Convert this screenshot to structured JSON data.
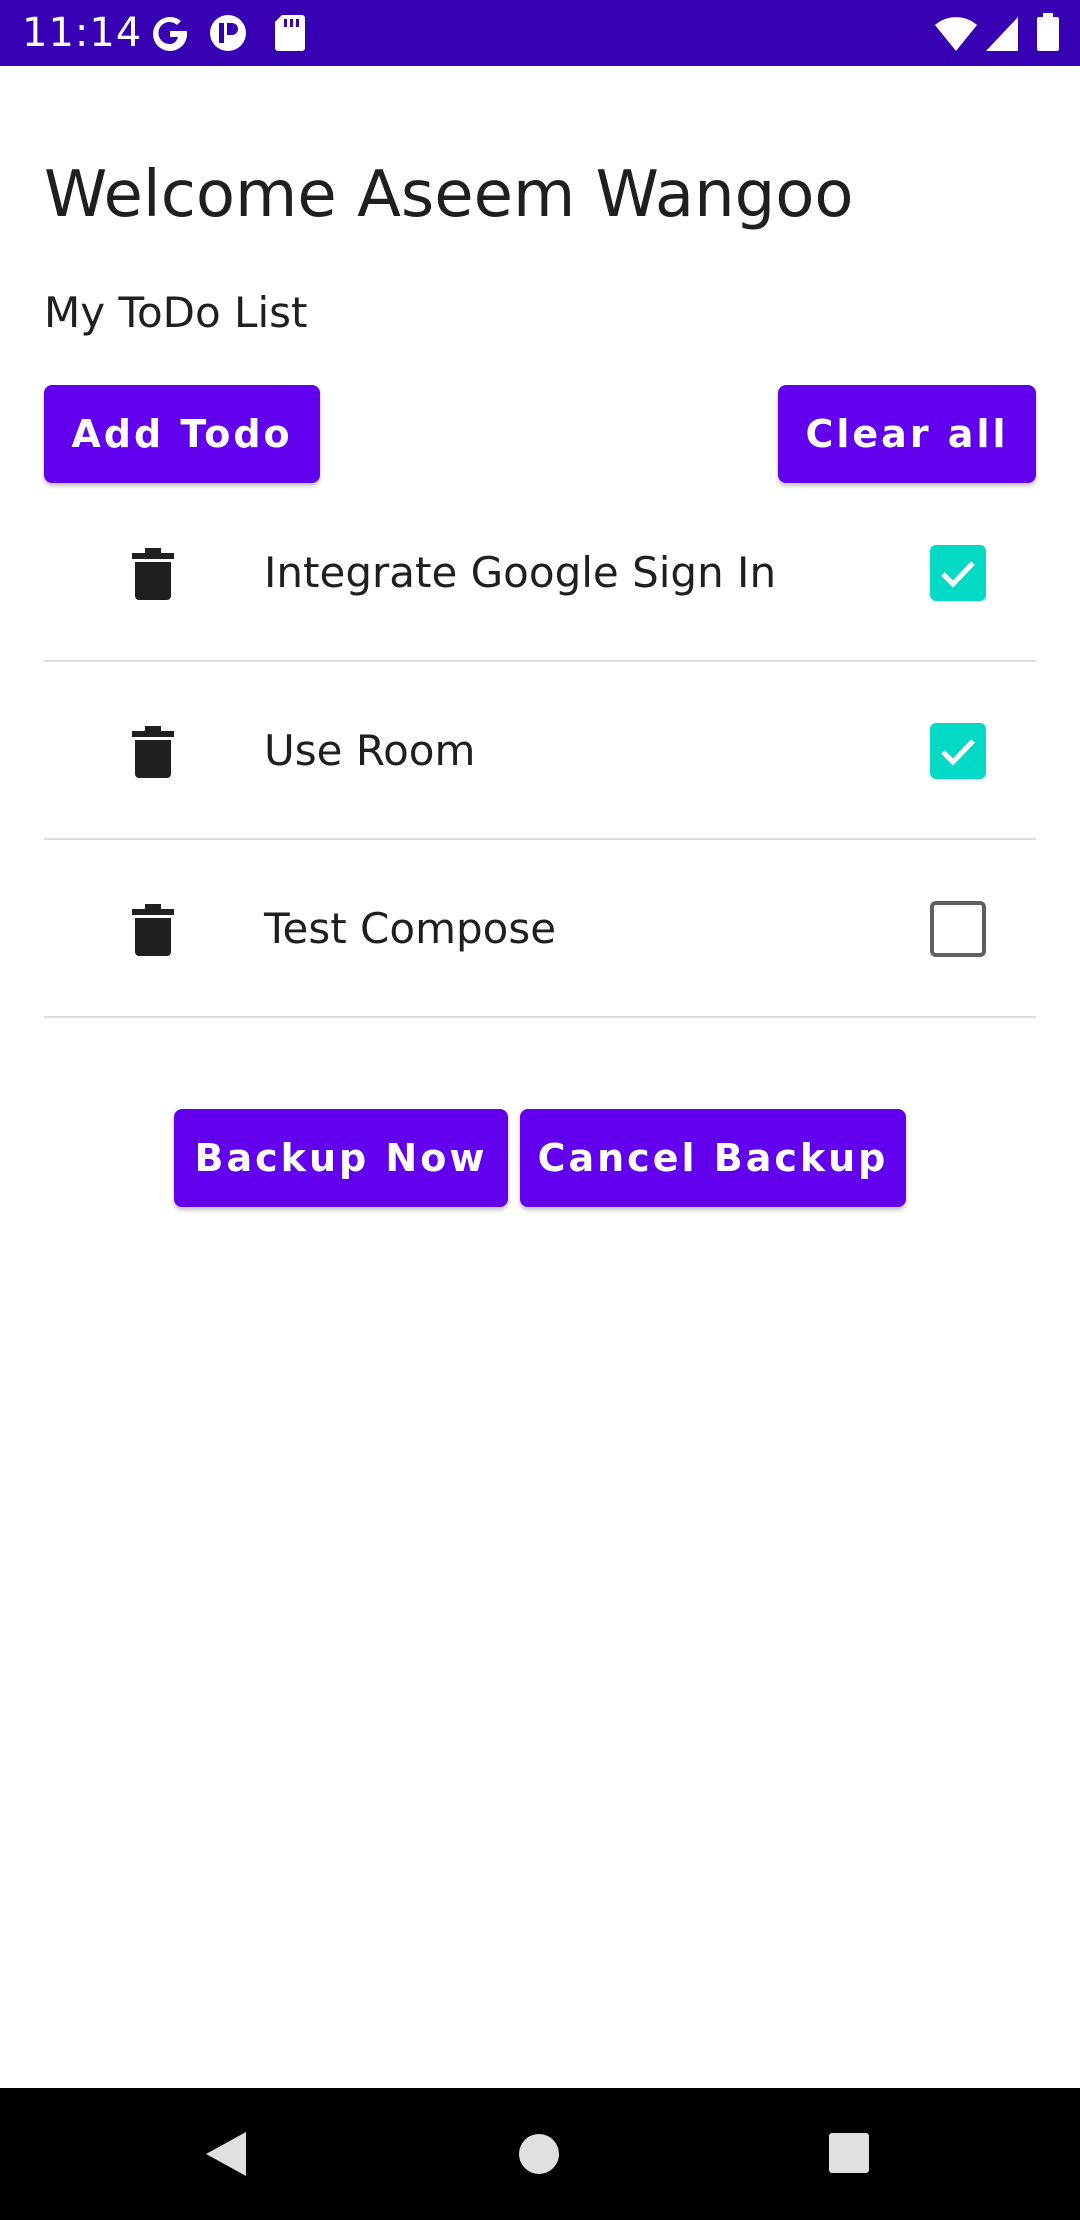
{
  "status_bar": {
    "time": "11:14",
    "background": "#3700b3",
    "left_icons": [
      "google-g-icon",
      "notification-app-icon",
      "sd-card-icon"
    ],
    "right_icons": [
      "wifi-icon",
      "cell-signal-icon",
      "battery-icon"
    ]
  },
  "header": {
    "welcome": "Welcome Aseem Wangoo",
    "subtitle": "My ToDo List"
  },
  "actions": {
    "add_label": "Add Todo",
    "clear_label": "Clear all"
  },
  "todos": [
    {
      "text": "Integrate Google Sign In",
      "checked": true
    },
    {
      "text": "Use Room",
      "checked": true
    },
    {
      "text": "Test Compose",
      "checked": false
    }
  ],
  "backup": {
    "backup_label": "Backup Now",
    "cancel_label": "Cancel Backup"
  },
  "colors": {
    "primary": "#6200ee",
    "primary_dark": "#3700b3",
    "checkbox_checked": "#03dac5"
  },
  "nav_bar": {
    "icons": [
      "back-icon",
      "home-icon",
      "recents-icon"
    ]
  }
}
